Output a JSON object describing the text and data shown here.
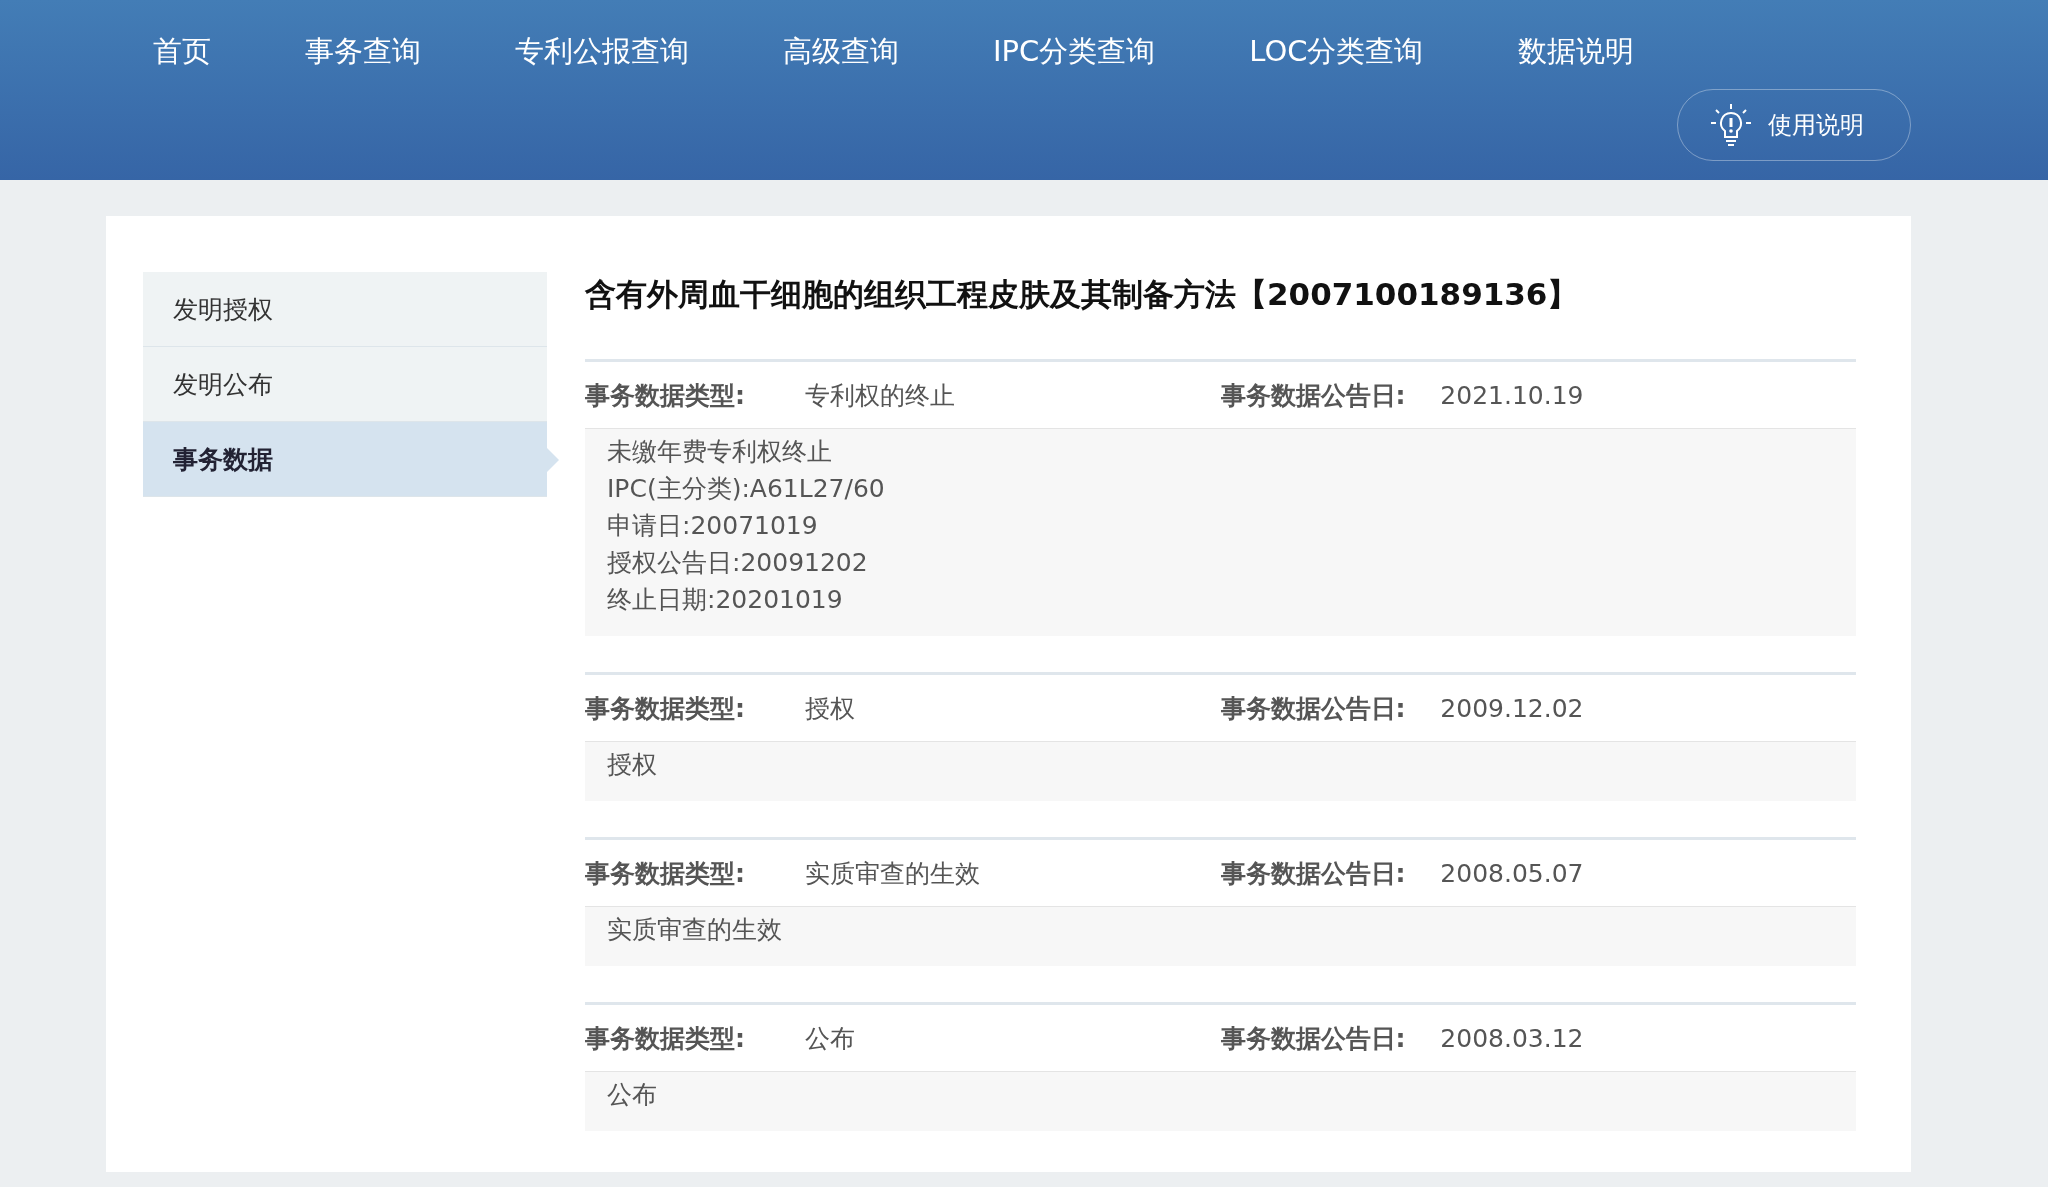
{
  "nav": {
    "items": [
      {
        "label": "首页"
      },
      {
        "label": "事务查询"
      },
      {
        "label": "专利公报查询"
      },
      {
        "label": "高级查询"
      },
      {
        "label": "IPC分类查询"
      },
      {
        "label": "LOC分类查询"
      },
      {
        "label": "数据说明"
      }
    ],
    "help_button": {
      "label": "使用说明"
    }
  },
  "sidebar": {
    "items": [
      {
        "label": "发明授权",
        "selected": false
      },
      {
        "label": "发明公布",
        "selected": false
      },
      {
        "label": "事务数据",
        "selected": true
      }
    ]
  },
  "title": "含有外周血干细胞的组织工程皮肤及其制备方法【2007100189136】",
  "records": [
    {
      "type_label": "事务数据类型:",
      "type_value": "专利权的终止",
      "date_label": "事务数据公告日:",
      "date_value": "2021.10.19",
      "details": [
        "未缴年费专利权终止",
        "IPC(主分类):A61L27/60",
        "申请日:20071019",
        "授权公告日:20091202",
        "终止日期:20201019"
      ]
    },
    {
      "type_label": "事务数据类型:",
      "type_value": "授权",
      "date_label": "事务数据公告日:",
      "date_value": "2009.12.02",
      "details": [
        "授权"
      ]
    },
    {
      "type_label": "事务数据类型:",
      "type_value": "实质审查的生效",
      "date_label": "事务数据公告日:",
      "date_value": "2008.05.07",
      "details": [
        "实质审查的生效"
      ]
    },
    {
      "type_label": "事务数据类型:",
      "type_value": "公布",
      "date_label": "事务数据公告日:",
      "date_value": "2008.03.12",
      "details": [
        "公布"
      ]
    }
  ]
}
